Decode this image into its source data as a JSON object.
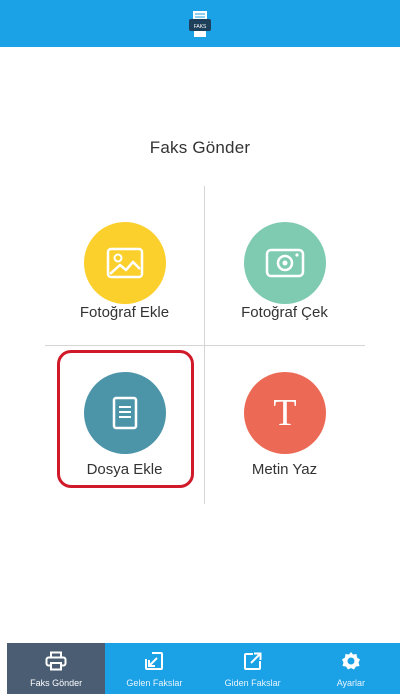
{
  "header": {
    "logo_text": "FAKS"
  },
  "page": {
    "title": "Faks Gönder"
  },
  "actions": [
    {
      "label": "Fotoğraf Ekle",
      "color": "#fbd02d",
      "icon": "image-icon"
    },
    {
      "label": "Fotoğraf Çek",
      "color": "#7fcbb1",
      "icon": "camera-icon"
    },
    {
      "label": "Dosya Ekle",
      "color": "#4c94a8",
      "icon": "document-icon"
    },
    {
      "label": "Metin Yaz",
      "color": "#ec6a55",
      "icon": "text-icon",
      "glyph": "T"
    }
  ],
  "tabs": [
    {
      "label": "Faks Gönder",
      "icon": "printer-icon",
      "active": true
    },
    {
      "label": "Gelen Fakslar",
      "icon": "incoming-icon",
      "active": false
    },
    {
      "label": "Giden Fakslar",
      "icon": "outgoing-icon",
      "active": false
    },
    {
      "label": "Ayarlar",
      "icon": "gear-icon",
      "active": false
    }
  ],
  "colors": {
    "brand": "#1ba1e6",
    "active_tab": "#4a5d72",
    "highlight": "#d01a2a"
  }
}
